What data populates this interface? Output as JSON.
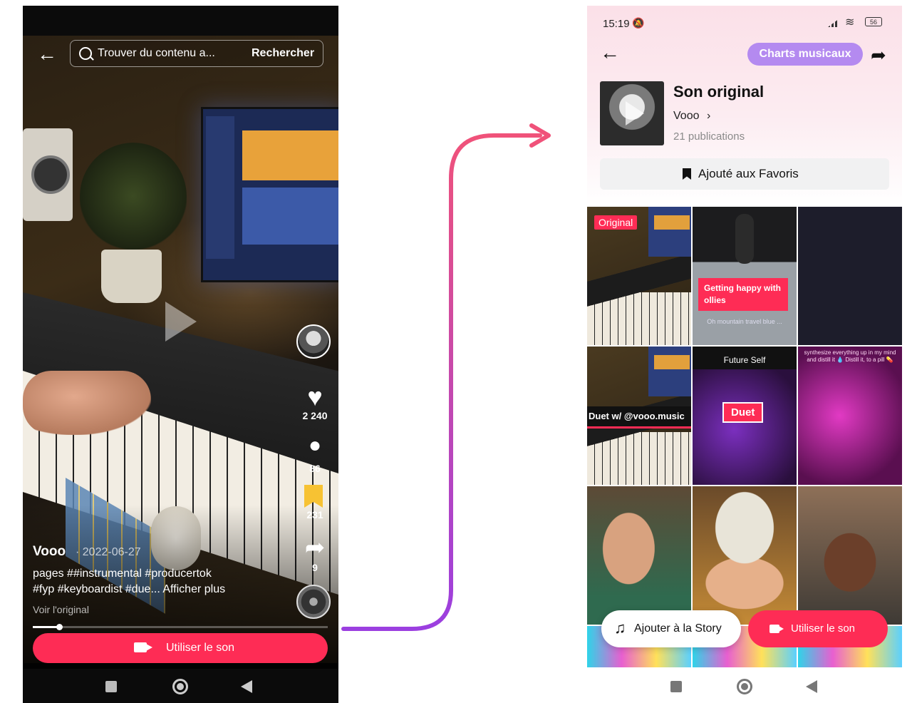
{
  "left": {
    "search": {
      "placeholder": "Trouver du contenu a...",
      "button": "Rechercher"
    },
    "video": {
      "author": "Vooo",
      "date": "· 2022-06-27",
      "caption_line1": "pages ##instrumental #producertok",
      "caption_line2": "#fyp #keyboardist #due...  Afficher plus",
      "original_link": "Voir l'original"
    },
    "actions": {
      "likes": "2 240",
      "comments": "86",
      "saves": "231",
      "shares": "9"
    },
    "progress_fraction": 0.09,
    "use_sound_label": "Utiliser le son",
    "icons": [
      "back-arrow-icon",
      "search-icon",
      "play-icon",
      "heart-icon",
      "comment-icon",
      "bookmark-icon",
      "share-icon",
      "camera-icon"
    ]
  },
  "right": {
    "status": {
      "time": "15:19",
      "battery": "56"
    },
    "charts_label": "Charts musicaux",
    "sound": {
      "title": "Son original",
      "artist": "Vooo",
      "publications": "21 publications"
    },
    "favorites_label": "Ajouté aux Favoris",
    "tiles": {
      "t1": {
        "tag": "Original"
      },
      "t2": {
        "tag": "Getting happy with ollies",
        "sub": "Oh mountain travel blue ..."
      },
      "t5": {
        "tag": "Future Self",
        "tag2": "Duet"
      },
      "t4": {
        "tag": "Duet w/ @vooo.music"
      },
      "t6": {
        "tag": "synthesize everything up in my mind and distill it 💧 Distill it, to a pill 💊"
      }
    },
    "story_label": "Ajouter à la Story",
    "use_sound_label": "Utiliser le son",
    "colors": {
      "accent": "#fe2c55",
      "charts": "#b48af0",
      "arrow_start": "#f0527a",
      "arrow_end": "#9b3fe0"
    }
  }
}
